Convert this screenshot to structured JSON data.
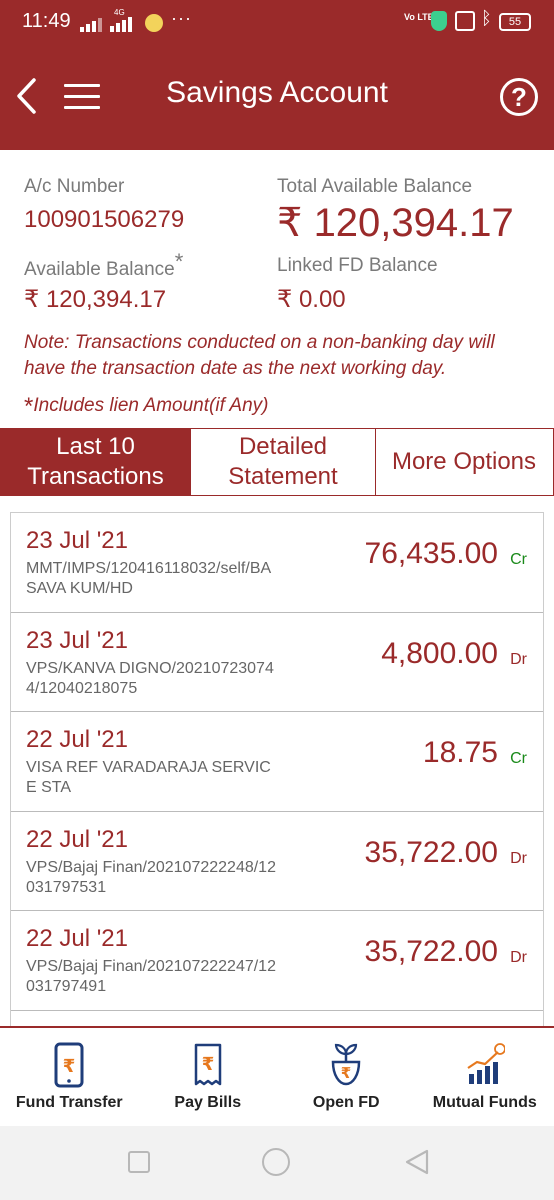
{
  "status": {
    "time": "11:49",
    "network": "4G",
    "dots": "···",
    "volte": "Vo LTE",
    "battery": "55"
  },
  "header": {
    "title": "Savings Account",
    "help_symbol": "?"
  },
  "account": {
    "number_label": "A/c Number",
    "number": "100901506279",
    "total_label": "Total Available Balance",
    "total_value": "₹ 120,394.17",
    "available_label": "Available Balance",
    "available_mark": "*",
    "available_value": "₹ 120,394.17",
    "fd_label": "Linked FD Balance",
    "fd_value": "₹ 0.00",
    "note": "Note: Transactions conducted on a non-banking day will have the transaction date as the next working day.",
    "lien_mark": "*",
    "lien_note": "Includes lien Amount(if Any)"
  },
  "tabs": [
    {
      "label": "Last 10 Transactions",
      "active": true
    },
    {
      "label": "Detailed Statement",
      "active": false
    },
    {
      "label": "More Options",
      "active": false
    }
  ],
  "transactions": [
    {
      "date": "23 Jul '21",
      "desc": "MMT/IMPS/120416118032/self/BASAVA KUM/HD",
      "amount": "76,435.00",
      "type": "Cr"
    },
    {
      "date": "23 Jul '21",
      "desc": "VPS/KANVA DIGNO/202107230744/12040218075",
      "amount": "4,800.00",
      "type": "Dr"
    },
    {
      "date": "22 Jul '21",
      "desc": "VISA REF VARADARAJA SERVICE STA",
      "amount": "18.75",
      "type": "Cr"
    },
    {
      "date": "22 Jul '21",
      "desc": "VPS/Bajaj Finan/202107222248/12031797531",
      "amount": "35,722.00",
      "type": "Dr"
    },
    {
      "date": "22 Jul '21",
      "desc": "VPS/Bajaj Finan/202107222247/12031797491",
      "amount": "35,722.00",
      "type": "Dr"
    }
  ],
  "bottom_nav": [
    {
      "label": "Fund Transfer",
      "icon": "phone-rupee-icon"
    },
    {
      "label": "Pay Bills",
      "icon": "bill-rupee-icon"
    },
    {
      "label": "Open FD",
      "icon": "plant-pot-rupee-icon"
    },
    {
      "label": "Mutual Funds",
      "icon": "growth-chart-icon"
    }
  ],
  "colors": {
    "brand": "#9a2a2a",
    "credit": "#1a8a1a",
    "debit": "#9a2a2a"
  }
}
